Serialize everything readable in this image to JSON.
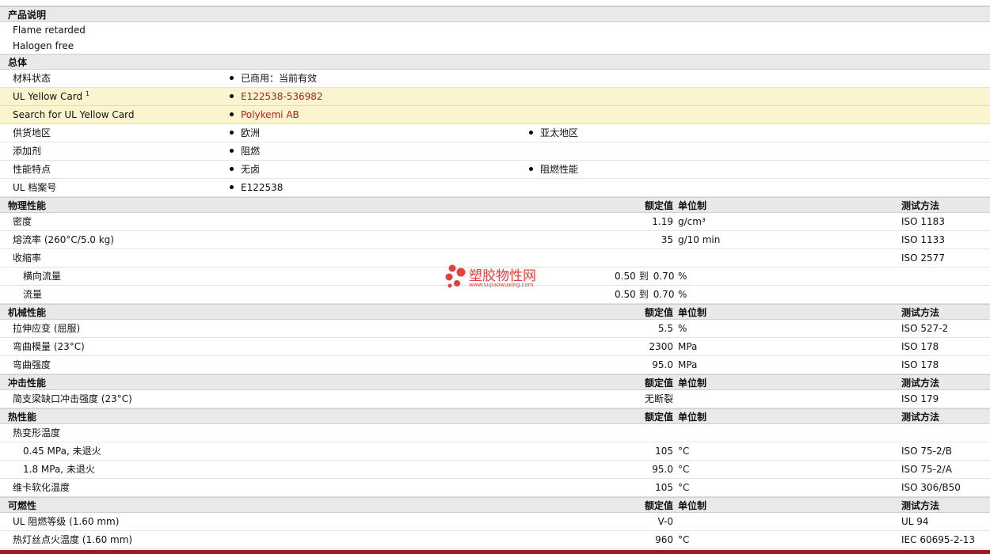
{
  "sections": {
    "desc": "产品说明",
    "general": "总体",
    "physical": "物理性能",
    "mechanical": "机械性能",
    "impact": "冲击性能",
    "thermal": "热性能",
    "flammability": "可燃性"
  },
  "headers": {
    "value": "额定值",
    "unit": "单位制",
    "method": "测试方法"
  },
  "desc": {
    "line1": "Flame retarded",
    "line2": "Halogen free"
  },
  "general": {
    "status_label": "材料状态",
    "status_value": "已商用：当前有效",
    "ul_card_label": "UL Yellow Card",
    "ul_card_sup": "1",
    "ul_card_value": "E122538-536982",
    "search_label": "Search for UL Yellow Card",
    "search_value": "Polykemi AB",
    "region_label": "供货地区",
    "region_1": "欧洲",
    "region_2": "亚太地区",
    "additive_label": "添加剂",
    "additive_1": "阻燃",
    "features_label": "性能特点",
    "features_1": "无卤",
    "features_2": "阻燃性能",
    "ulfile_label": "UL 档案号",
    "ulfile_1": "E122538"
  },
  "physical": {
    "density": {
      "label": "密度",
      "value": "1.19",
      "unit": "g/cm³",
      "method": "ISO 1183"
    },
    "mfr": {
      "label": "熔流率  (260°C/5.0 kg)",
      "value": "35",
      "unit": "g/10 min",
      "method": "ISO 1133"
    },
    "shrink": {
      "label": "收缩率",
      "method": "ISO 2577"
    },
    "shrink_td": {
      "label": "横向流量",
      "from": "0.50",
      "to_word": "到",
      "to": "0.70",
      "unit": "%"
    },
    "shrink_md": {
      "label": "流量",
      "from": "0.50",
      "to_word": "到",
      "to": "0.70",
      "unit": "%"
    }
  },
  "mechanical": {
    "tensile_strain": {
      "label": "拉伸应变  (屈服)",
      "value": "5.5",
      "unit": "%",
      "method": "ISO 527-2"
    },
    "flex_modulus": {
      "label": "弯曲模量  (23°C)",
      "value": "2300",
      "unit": "MPa",
      "method": "ISO 178"
    },
    "flex_strength": {
      "label": "弯曲强度",
      "value": "95.0",
      "unit": "MPa",
      "method": "ISO 178"
    }
  },
  "impact": {
    "charpy": {
      "label": "简支梁缺口冲击强度  (23°C)",
      "value": "无断裂",
      "method": "ISO 179"
    }
  },
  "thermal": {
    "hdt": {
      "label": "热变形温度"
    },
    "hdt_045": {
      "label": "0.45 MPa, 未退火",
      "value": "105",
      "unit": "°C",
      "method": "ISO 75-2/B"
    },
    "hdt_18": {
      "label": "1.8 MPa, 未退火",
      "value": "95.0",
      "unit": "°C",
      "method": "ISO 75-2/A"
    },
    "vicat": {
      "label": "维卡软化温度",
      "value": "105",
      "unit": "°C",
      "method": "ISO 306/B50"
    }
  },
  "flammability": {
    "ul94": {
      "label": "UL 阻燃等级  (1.60 mm)",
      "value": "V-0",
      "method": "UL 94"
    },
    "gwit": {
      "label": "热灯丝点火温度  (1.60 mm)",
      "value": "960",
      "unit": "°C",
      "method": "IEC 60695-2-13"
    }
  },
  "watermark": {
    "title": "塑胶物性网",
    "url": "www.sujiaowuxing.com",
    "color": "#e34040"
  },
  "colors": {
    "section_bg": "#e9e9e9",
    "highlight_bg": "#fbf5cf",
    "link_red": "#b01e1e",
    "bottom_bar": "#a01818"
  }
}
